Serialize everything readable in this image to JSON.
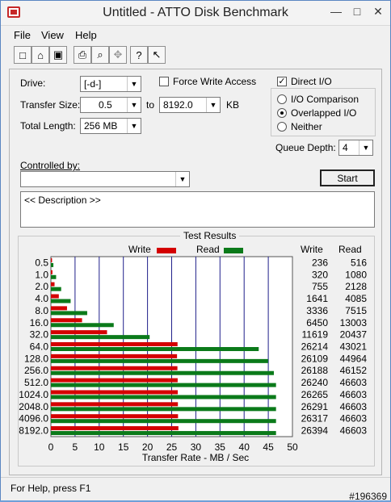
{
  "window": {
    "title": "Untitled - ATTO Disk Benchmark"
  },
  "menu": {
    "items": [
      "File",
      "View",
      "Help"
    ]
  },
  "toolbar": {
    "icons": [
      "new-file-icon",
      "open-folder-icon",
      "save-icon",
      "print-icon",
      "print-preview-icon",
      "move-icon",
      "help-icon",
      "context-help-icon"
    ]
  },
  "settings": {
    "drive_label": "Drive:",
    "drive_value": "[-d-]",
    "transfer_size_label": "Transfer Size:",
    "transfer_from": "0.5",
    "to_label": "to",
    "transfer_to": "8192.0",
    "unit": "KB",
    "total_length_label": "Total Length:",
    "total_length_value": "256 MB",
    "force_write_access": "Force Write Access",
    "direct_io": "Direct I/O",
    "io_comparison": "I/O Comparison",
    "overlapped_io": "Overlapped I/O",
    "neither": "Neither",
    "queue_depth_label": "Queue Depth:",
    "queue_depth_value": "4",
    "controlled_by_label": "Controlled by:",
    "controlled_by_value": "",
    "start_button": "Start",
    "description": "<< Description >>"
  },
  "results": {
    "title": "Test Results",
    "write_legend": "Write",
    "read_legend": "Read",
    "write_col": "Write",
    "read_col": "Read",
    "x_title": "Transfer Rate - MB / Sec"
  },
  "status": {
    "text": "For Help, press F1",
    "watermark": "#196369"
  },
  "colors": {
    "write": "#d40000",
    "read": "#0b7a1a",
    "grid": "#1f1f8a"
  },
  "chart_data": {
    "type": "bar",
    "categories": [
      "0.5",
      "1.0",
      "2.0",
      "4.0",
      "8.0",
      "16.0",
      "32.0",
      "64.0",
      "128.0",
      "256.0",
      "512.0",
      "1024.0",
      "2048.0",
      "4096.0",
      "8192.0"
    ],
    "series": [
      {
        "name": "Write",
        "values": [
          236,
          320,
          755,
          1641,
          3336,
          6450,
          11619,
          26214,
          26109,
          26188,
          26240,
          26265,
          26291,
          26317,
          26394
        ]
      },
      {
        "name": "Read",
        "values": [
          516,
          1080,
          2128,
          4085,
          7515,
          13003,
          20437,
          43021,
          44964,
          46152,
          46603,
          46603,
          46603,
          46603,
          46603
        ]
      }
    ],
    "xlabel": "Transfer Rate - MB / Sec",
    "xlim": [
      0,
      50
    ],
    "ticks": [
      "0",
      "5",
      "10",
      "15",
      "20",
      "25",
      "30",
      "35",
      "40",
      "45",
      "50"
    ]
  }
}
